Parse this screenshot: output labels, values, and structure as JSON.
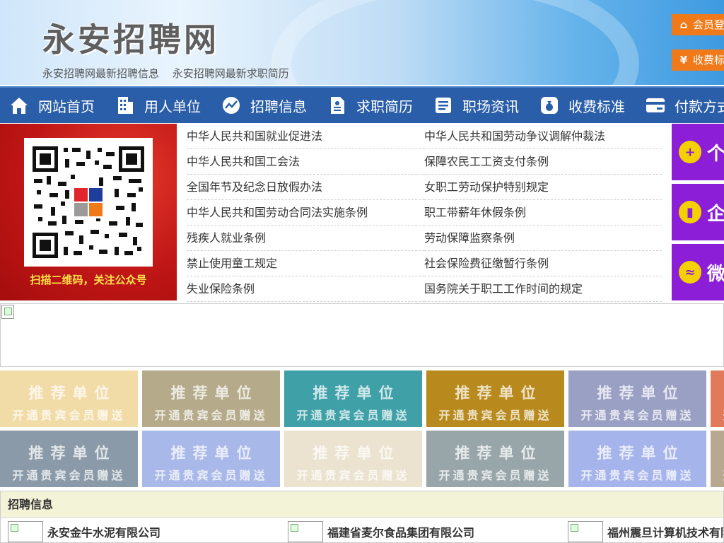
{
  "header": {
    "site_title": "永安招聘网",
    "sub_links": [
      "永安招聘网最新招聘信息",
      "永安招聘网最新求职简历"
    ],
    "member_login": "会员登",
    "fees": "收费标"
  },
  "nav": {
    "items": [
      {
        "label": "网站首页",
        "icon": "home-icon"
      },
      {
        "label": "用人单位",
        "icon": "building-icon"
      },
      {
        "label": "招聘信息",
        "icon": "chart-icon"
      },
      {
        "label": "求职简历",
        "icon": "resume-icon"
      },
      {
        "label": "职场资讯",
        "icon": "news-icon"
      },
      {
        "label": "收费标准",
        "icon": "money-bag-icon"
      },
      {
        "label": "付款方式",
        "icon": "card-icon"
      }
    ]
  },
  "qr": {
    "caption": "扫描二维码，关注公众号"
  },
  "laws": {
    "left": [
      "中华人民共和国就业促进法",
      "中华人民共和国工会法",
      "全国年节及纪念日放假办法",
      "中华人民共和国劳动合同法实施条例",
      "残疾人就业条例",
      "禁止使用童工规定",
      "失业保险条例"
    ],
    "right": [
      "中华人民共和国劳动争议调解仲裁法",
      "保障农民工工资支付条例",
      "女职工劳动保护特别规定",
      "职工带薪年休假条例",
      "劳动保障监察条例",
      "社会保险费征缴暂行条例",
      "国务院关于职工工作时间的规定"
    ]
  },
  "side_buttons": [
    {
      "label": "个",
      "icon": "person-add-icon"
    },
    {
      "label": "企",
      "icon": "company-icon"
    },
    {
      "label": "微",
      "icon": "wechat-icon"
    }
  ],
  "tiles": {
    "title": "推荐单位",
    "subtitle": "开通贵宾会员赠送",
    "colors_row1": [
      "#f1dca8",
      "#b5aa8a",
      "#3fa0a8",
      "#b88a1e",
      "#9aa0c4",
      "#e07a5a"
    ],
    "colors_row2": [
      "#8a9aa8",
      "#a8b8e8",
      "#ebe2cf",
      "#98a6aa",
      "#a6b4ec",
      "#b8a890"
    ]
  },
  "recruit": {
    "heading": "招聘信息",
    "companies": [
      "永安金牛水泥有限公司",
      "福建省麦尔食品集团有限公司",
      "福州震旦计算机技术有限"
    ]
  }
}
